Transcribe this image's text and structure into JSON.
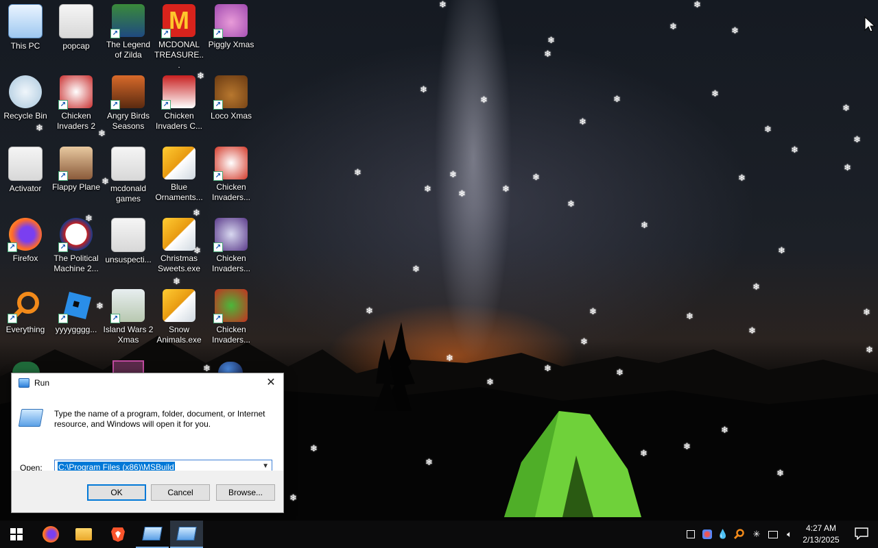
{
  "desktop": {
    "icons": [
      {
        "label": "This PC",
        "icon": "this-pc-icon"
      },
      {
        "label": "popcap",
        "icon": "popcap-icon"
      },
      {
        "label": "The Legend of Zilda",
        "icon": "legend-of-zilda-icon"
      },
      {
        "label": "MCDONAL TREASURE...",
        "icon": "mcdonald-icon"
      },
      {
        "label": "Piggly Xmas",
        "icon": "piggly-icon"
      },
      {
        "label": "Recycle Bin",
        "icon": "recycle-bin-icon"
      },
      {
        "label": "Chicken Invaders 2",
        "icon": "chicken-invaders-icon"
      },
      {
        "label": "Angry Birds Seasons",
        "icon": "angry-birds-icon"
      },
      {
        "label": "Chicken Invaders C...",
        "icon": "chicken-invaders-icon"
      },
      {
        "label": "Loco Xmas",
        "icon": "loco-xmas-icon"
      },
      {
        "label": "Activator",
        "icon": "file-icon"
      },
      {
        "label": "Flappy Plane",
        "icon": "flappy-plane-icon"
      },
      {
        "label": "mcdonald games",
        "icon": "file-icon"
      },
      {
        "label": "Blue Ornaments...",
        "icon": "game-installer-icon"
      },
      {
        "label": "Chicken Invaders...",
        "icon": "chicken-invaders-icon"
      },
      {
        "label": "Firefox",
        "icon": "firefox-icon"
      },
      {
        "label": "The Political Machine 2...",
        "icon": "political-machine-icon"
      },
      {
        "label": "unsuspecti...",
        "icon": "file-icon"
      },
      {
        "label": "Christmas Sweets.exe",
        "icon": "game-installer-icon"
      },
      {
        "label": "Chicken Invaders...",
        "icon": "chicken-invaders-icon"
      },
      {
        "label": "Everything",
        "icon": "search-icon"
      },
      {
        "label": "yyyygggg...",
        "icon": "roblox-icon"
      },
      {
        "label": "Island Wars 2 Xmas",
        "icon": "island-wars-icon"
      },
      {
        "label": "Snow Animals.exe",
        "icon": "game-installer-icon"
      },
      {
        "label": "Chicken Invaders...",
        "icon": "chicken-invaders-icon"
      }
    ]
  },
  "run_dialog": {
    "title": "Run",
    "description": "Type the name of a program, folder, document, or Internet resource, and Windows will open it for you.",
    "open_label": "Open:",
    "open_value": "C:\\Program Files (x86)\\MSBuild",
    "ok_label": "OK",
    "cancel_label": "Cancel",
    "browse_label": "Browse..."
  },
  "taskbar": {
    "apps": [
      {
        "name": "start-button",
        "icon": "windows-logo-icon"
      },
      {
        "name": "firefox",
        "icon": "firefox-icon"
      },
      {
        "name": "file-explorer",
        "icon": "folder-icon"
      },
      {
        "name": "brave",
        "icon": "brave-icon"
      },
      {
        "name": "run-app-1",
        "icon": "run-icon"
      },
      {
        "name": "run-app-2",
        "icon": "run-icon"
      }
    ],
    "time": "4:27 AM",
    "date": "2/13/2025"
  },
  "colors": {
    "accent": "#0078d7",
    "taskbar": "#0b0b0c",
    "tent": "#6fd13a"
  }
}
